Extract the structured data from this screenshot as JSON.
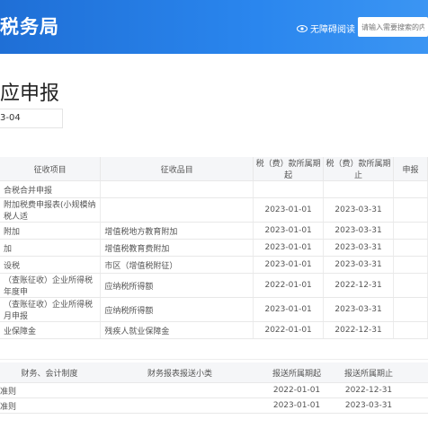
{
  "header": {
    "brand": "税务局",
    "accessibility_label": "无障碍阅读",
    "search_placeholder": "请输入需要搜索的内"
  },
  "page": {
    "title": "应申报",
    "date": "3-04"
  },
  "tax_table": {
    "columns": [
      "征收项目",
      "征收品目",
      "税（费）款所属期起",
      "税（费）款所属期止",
      "申报"
    ],
    "rows": [
      {
        "item": "合税合并申报",
        "sub": "",
        "start": "",
        "end": ""
      },
      {
        "item": "附加税费申报表(小规模纳税人适",
        "sub": "",
        "start": "2023-01-01",
        "end": "2023-03-31"
      },
      {
        "item": "附加",
        "sub": "增值税地方教育附加",
        "start": "2023-01-01",
        "end": "2023-03-31"
      },
      {
        "item": "加",
        "sub": "增值税教育费附加",
        "start": "2023-01-01",
        "end": "2023-03-31"
      },
      {
        "item": "设税",
        "sub": "市区（增值税附征）",
        "start": "2023-01-01",
        "end": "2023-03-31"
      },
      {
        "item": "（查账征收）企业所得税年度申",
        "sub": "应纳税所得额",
        "start": "2022-01-01",
        "end": "2022-12-31"
      },
      {
        "item": "（查账征收）企业所得税月申报",
        "sub": "应纳税所得额",
        "start": "2023-01-01",
        "end": "2023-03-31"
      },
      {
        "item": "业保障金",
        "sub": "残疾人就业保障金",
        "start": "2022-01-01",
        "end": "2022-12-31"
      }
    ]
  },
  "finance_table": {
    "columns": [
      "财务、会计制度",
      "财务报表报送小类",
      "报送所属期起",
      "报送所属期止"
    ],
    "rows": [
      {
        "name": "准则",
        "sub": "",
        "start": "2022-01-01",
        "end": "2022-12-31"
      },
      {
        "name": "准则",
        "sub": "",
        "start": "2023-01-01",
        "end": "2023-03-31"
      }
    ]
  }
}
